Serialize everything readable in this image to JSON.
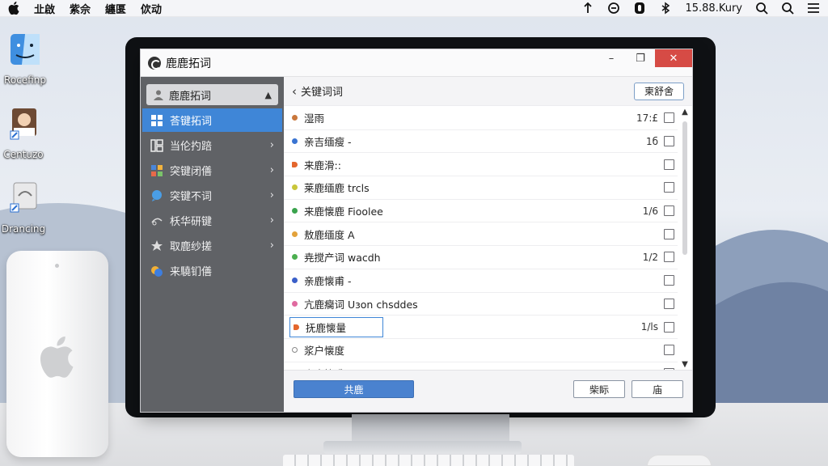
{
  "menubar": {
    "items": [
      "㐀啟",
      "紫佘",
      "纏匽",
      "佽动"
    ],
    "clock": "15.88.Kury"
  },
  "desktop": {
    "icons": [
      {
        "label": "Rocefinp"
      },
      {
        "label": "Centuzo"
      },
      {
        "label": "Drancing"
      }
    ]
  },
  "dialog": {
    "title": "鹿鹿拓词",
    "sidebar": {
      "header": "鹿鹿拓词",
      "items": [
        {
          "label": "荅键拓词",
          "icon": "grid-icon",
          "active": true
        },
        {
          "label": "当伦扚踣",
          "icon": "columns-icon"
        },
        {
          "label": "突键闭僐",
          "icon": "tiles-icon"
        },
        {
          "label": "突键不词",
          "icon": "chat-icon"
        },
        {
          "label": "枖华研键",
          "icon": "link-icon"
        },
        {
          "label": "取鹿纱搓",
          "icon": "star-icon"
        },
        {
          "label": "来驍钔僐",
          "icon": "color-icon"
        }
      ]
    },
    "main": {
      "back_label": "关键词词",
      "header_button": "柬舒舍",
      "rows": [
        {
          "label": "湿雨",
          "color": "#c9773c",
          "count": "17:£",
          "checked": false
        },
        {
          "label": "亲吉缅瘦 -",
          "color": "#3a74d2",
          "count": "1б",
          "checked": false
        },
        {
          "label": "来鹿滑::",
          "color": "#e4662d",
          "count": "",
          "checked": false,
          "marker": "flag"
        },
        {
          "label": "莱鹿缅鹿 trcls",
          "color": "#c9c63a",
          "count": "",
          "checked": false
        },
        {
          "label": "来鹿懐鹿 Fioolee",
          "color": "#3aa34d",
          "count": "1/6",
          "checked": false
        },
        {
          "label": "敖鹿缅度 A",
          "color": "#e3a23a",
          "count": "",
          "checked": false
        },
        {
          "label": "尭搅产词 wacdh",
          "color": "#4caf50",
          "count": "1/2",
          "checked": false
        },
        {
          "label": "亲鹿懐甫 -",
          "color": "#3a5fc9",
          "count": "",
          "checked": false
        },
        {
          "label": "亢鹿癵词 Uзon chsddes",
          "color": "#e06aa0",
          "count": "",
          "checked": false
        },
        {
          "label": "抚鹿懐量",
          "color": "#e4662d",
          "count": "1/ls",
          "checked": false,
          "editing": true
        },
        {
          "label": "浆户懐度",
          "color": "#ffffff",
          "count": "",
          "checked": false
        },
        {
          "label": "来鹿懐甫 Ala",
          "color": "#d4b12a",
          "count": "",
          "checked": false
        }
      ]
    },
    "footer": {
      "primary_button": "共鹿",
      "secondary_button_1": "柴眎",
      "secondary_button_2": "庙"
    }
  }
}
